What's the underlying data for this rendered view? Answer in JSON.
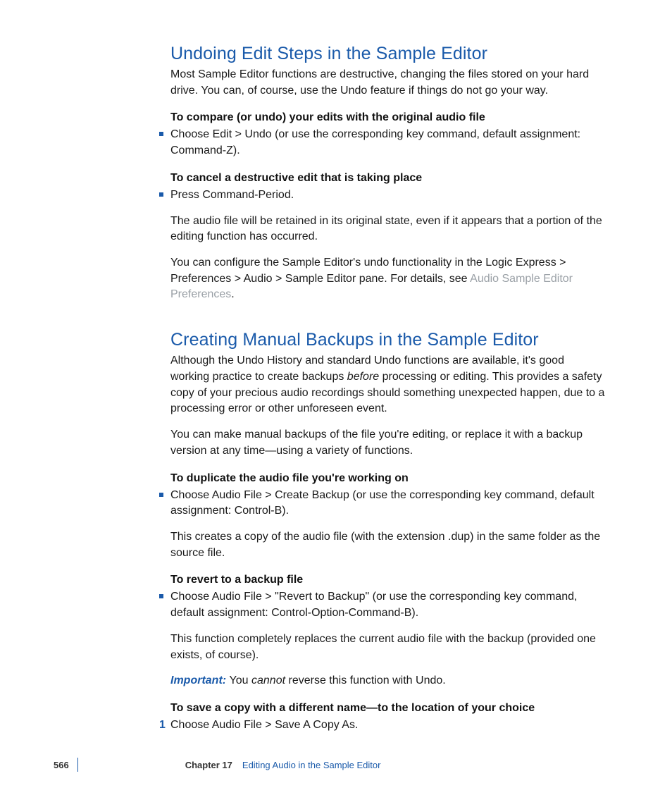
{
  "section1": {
    "heading": "Undoing Edit Steps in the Sample Editor",
    "intro": "Most Sample Editor functions are destructive, changing the files stored on your hard drive. You can, of course, use the Undo feature if things do not go your way.",
    "sub1": "To compare (or undo) your edits with the original audio file",
    "b1": "Choose Edit > Undo (or use the corresponding key command, default assignment:  Command-Z).",
    "sub2": "To cancel a destructive edit that is taking place",
    "b2": "Press Command-Period.",
    "b2_after1": "The audio file will be retained in its original state, even if it appears that a portion of the editing function has occurred.",
    "b2_after2_pre": "You can configure the Sample Editor's undo functionality in the Logic Express > Preferences > Audio > Sample Editor pane. For details, see ",
    "b2_after2_link": "Audio Sample Editor Preferences",
    "b2_after2_post": "."
  },
  "section2": {
    "heading": "Creating Manual Backups in the Sample Editor",
    "intro_pre": "Although the Undo History and standard Undo functions are available, it's good working practice to create backups ",
    "intro_em": "before",
    "intro_post": " processing or editing. This provides a safety copy of your precious audio recordings should something unexpected happen, due to a processing error or other unforeseen event.",
    "p2": "You can make manual backups of the file you're editing, or replace it with a backup version at any time—using a variety of functions.",
    "sub1": "To duplicate the audio file you're working on",
    "b1": "Choose Audio File > Create Backup (or use the corresponding key command, default assignment:  Control-B).",
    "b1_after": "This creates a copy of the audio file (with the extension .dup) in the same folder as the source file.",
    "sub2": "To revert to a backup file",
    "b2": "Choose Audio File > \"Revert to Backup\" (or use the corresponding key command, default assignment:  Control-Option-Command-B).",
    "b2_after": "This function completely replaces the current audio file with the backup (provided one exists, of course).",
    "important_label": "Important:  ",
    "important_pre": "You ",
    "important_em": "cannot",
    "important_post": " reverse this function with Undo.",
    "sub3": "To save a copy with a different name—to the location of your choice",
    "n1_num": "1",
    "n1": "Choose Audio File > Save A Copy As."
  },
  "footer": {
    "page": "566",
    "chapter": "Chapter 17",
    "title": "Editing Audio in the Sample Editor"
  }
}
